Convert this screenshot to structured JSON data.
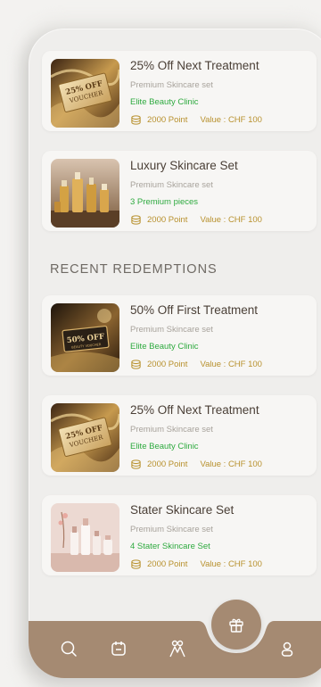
{
  "colors": {
    "accent_brown": "#a58a72",
    "tag_green": "#2eaa3f",
    "points_gold": "#b8912e"
  },
  "top_cards": [
    {
      "title": "25% Off Next Treatment",
      "subtitle": "Premium Skincare set",
      "tag": "Elite Beauty Clinic",
      "points": "2000 Point",
      "value": "Value : CHF 100",
      "image": "voucher-25-off"
    },
    {
      "title": "Luxury Skincare Set",
      "subtitle": "Premium Skincare set",
      "tag": "3 Premium pieces",
      "points": "2000 Point",
      "value": "Value : CHF 100",
      "image": "gold-serum-bottles"
    }
  ],
  "recent_section_title": "RECENT REDEMPTIONS",
  "recent_cards": [
    {
      "title": "50% Off First Treatment",
      "subtitle": "Premium Skincare set",
      "tag": "Elite Beauty Clinic",
      "points": "2000 Point",
      "value": "Value : CHF 100",
      "image": "voucher-50-off"
    },
    {
      "title": "25% Off Next Treatment",
      "subtitle": "Premium Skincare set",
      "tag": "Elite Beauty Clinic",
      "points": "2000 Point",
      "value": "Value : CHF 100",
      "image": "voucher-25-off"
    },
    {
      "title": "Stater Skincare Set",
      "subtitle": "Premium Skincare set",
      "tag": "4 Stater Skincare Set",
      "points": "2000 Point",
      "value": "Value : CHF 100",
      "image": "pink-skincare-bottles"
    }
  ],
  "thumb_text": {
    "voucher25_line1": "25% OFF",
    "voucher25_line2": "VOUCHER",
    "voucher50_line1": "50% OFF",
    "voucher50_line2": "BEAUTY VOUCHER"
  },
  "bottom_nav": {
    "items": [
      "search-icon",
      "calendar-icon",
      "community-icon",
      "gift-icon",
      "profile-icon"
    ],
    "active": "gift-icon"
  }
}
